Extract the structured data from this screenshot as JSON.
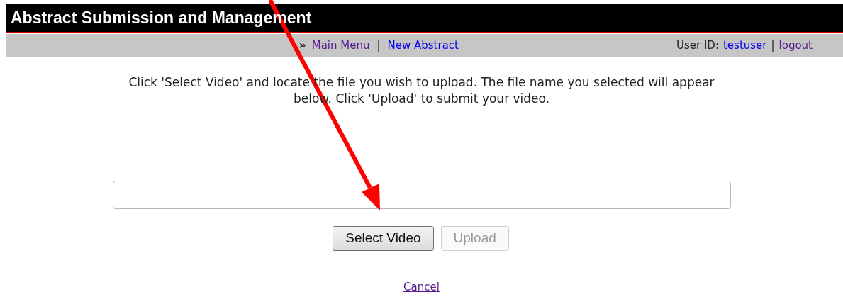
{
  "header": {
    "title": "Abstract Submission and Management"
  },
  "nav": {
    "marker": "»",
    "separator": "|",
    "user_separator": "|",
    "links": [
      {
        "label": "Main Menu",
        "visited": true
      },
      {
        "label": "New Abstract",
        "visited": false
      }
    ],
    "user_label": "User ID:",
    "user_links": [
      {
        "label": "testuser",
        "visited": false
      },
      {
        "label": "logout",
        "visited": true
      }
    ]
  },
  "instructions": "Click 'Select Video' and locate the file you wish to upload. The file name you selected will appear below. Click 'Upload' to submit your video.",
  "buttons": [
    {
      "label": "Select Video",
      "disabled": false
    },
    {
      "label": "Upload",
      "disabled": true
    }
  ],
  "cancel": {
    "label": "Cancel",
    "visited": true
  }
}
